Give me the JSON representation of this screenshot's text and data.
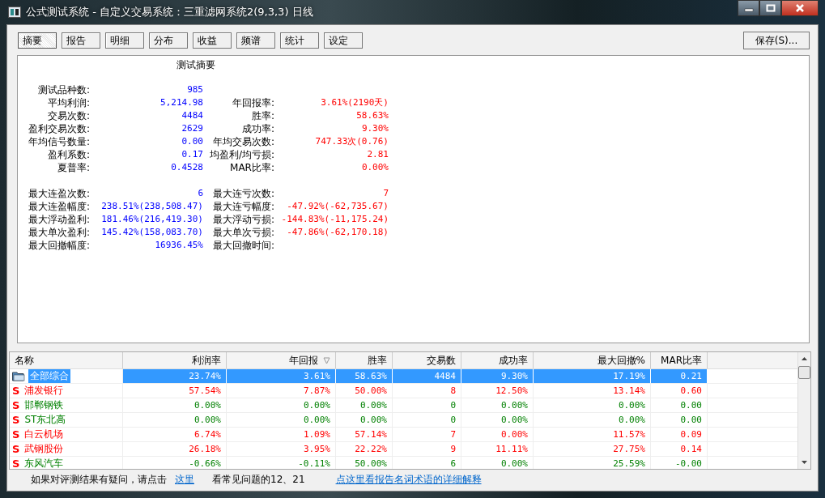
{
  "window": {
    "title": "公式测试系统 - 自定义交易系统：三重滤网系统2(9,3,3) 日线"
  },
  "tabs": [
    {
      "label": "摘要",
      "selected": true
    },
    {
      "label": "报告",
      "selected": false
    },
    {
      "label": "明细",
      "selected": false
    },
    {
      "label": "分布",
      "selected": false
    },
    {
      "label": "收益",
      "selected": false
    },
    {
      "label": "频谱",
      "selected": false
    },
    {
      "label": "统计",
      "selected": false
    },
    {
      "label": "设定",
      "selected": false
    }
  ],
  "save_button": "保存(S)...",
  "summary": {
    "title": "测试摘要",
    "groups": [
      [
        {
          "label": "测试品种数:",
          "value": "985"
        },
        {
          "label": "平均利润:",
          "value": "5,214.98",
          "label2": "年回报率:",
          "value2": "3.61%(2190天)"
        },
        {
          "label": "交易次数:",
          "value": "4484",
          "label2": "胜率:",
          "value2": "58.63%"
        },
        {
          "label": "盈利交易次数:",
          "value": "2629",
          "label2": "成功率:",
          "value2": "9.30%"
        },
        {
          "label": "年均信号数量:",
          "value": "0.00",
          "label2": "年均交易次数:",
          "value2": "747.33次(0.76)"
        },
        {
          "label": "盈利系数:",
          "value": "0.17",
          "label2": "均盈利/均亏损:",
          "value2": "2.81"
        },
        {
          "label": "夏普率:",
          "value": "0.4528",
          "label2": "MAR比率:",
          "value2": "0.00%"
        }
      ],
      [
        {
          "label": "最大连盈次数:",
          "value": "6",
          "label2": "最大连亏次数:",
          "value2": "7"
        },
        {
          "label": "最大连盈幅度:",
          "value": "238.51%(238,508.47)",
          "label2": "最大连亏幅度:",
          "value2": "-47.92%(-62,735.67)"
        },
        {
          "label": "最大浮动盈利:",
          "value": "181.46%(216,419.30)",
          "label2": "最大浮动亏损:",
          "value2": "-144.83%(-11,175.24)"
        },
        {
          "label": "最大单次盈利:",
          "value": "145.42%(158,083.70)",
          "label2": "最大单次亏损:",
          "value2": "-47.86%(-62,170.18)"
        },
        {
          "label": "最大回撤幅度:",
          "value": "16936.45%",
          "label2": "最大回撤时间:"
        }
      ]
    ]
  },
  "table": {
    "columns": [
      {
        "label": "名称",
        "sorted": false
      },
      {
        "label": "利润率",
        "sorted": false
      },
      {
        "label": "年回报",
        "sorted": true
      },
      {
        "label": "胜率",
        "sorted": false
      },
      {
        "label": "交易数",
        "sorted": false
      },
      {
        "label": "成功率",
        "sorted": false
      },
      {
        "label": "最大回撤%",
        "sorted": false
      },
      {
        "label": "MAR比率",
        "sorted": false
      }
    ],
    "rows": [
      {
        "kind": "group",
        "selected": true,
        "cells": [
          "全部综合",
          "23.74%",
          "3.61%",
          "58.63%",
          "4484",
          "9.30%",
          "17.19%",
          "0.21"
        ]
      },
      {
        "kind": "stock",
        "marker": "S",
        "selected": false,
        "profitable": true,
        "cells": [
          "浦发银行",
          "57.54%",
          "7.87%",
          "50.00%",
          "8",
          "12.50%",
          "13.14%",
          "0.60"
        ]
      },
      {
        "kind": "stock",
        "marker": "S",
        "selected": false,
        "profitable": false,
        "cells": [
          "邯郸钢铁",
          "0.00%",
          "0.00%",
          "0.00%",
          "0",
          "0.00%",
          "0.00%",
          "0.00"
        ]
      },
      {
        "kind": "stock",
        "marker": "S",
        "selected": false,
        "profitable": false,
        "cells": [
          "ST东北高",
          "0.00%",
          "0.00%",
          "0.00%",
          "0",
          "0.00%",
          "0.00%",
          "0.00"
        ]
      },
      {
        "kind": "stock",
        "marker": "S",
        "selected": false,
        "profitable": true,
        "cells": [
          "白云机场",
          "6.74%",
          "1.09%",
          "57.14%",
          "7",
          "0.00%",
          "11.57%",
          "0.09"
        ]
      },
      {
        "kind": "stock",
        "marker": "S",
        "selected": false,
        "profitable": true,
        "cells": [
          "武钢股份",
          "26.18%",
          "3.95%",
          "22.22%",
          "9",
          "11.11%",
          "27.75%",
          "0.14"
        ]
      },
      {
        "kind": "stock",
        "marker": "S",
        "selected": false,
        "profitable": false,
        "cells": [
          "东风汽车",
          "-0.66%",
          "-0.11%",
          "50.00%",
          "6",
          "0.00%",
          "25.59%",
          "-0.00"
        ]
      }
    ]
  },
  "footer": {
    "text": "如果对评测结果有疑问，请点击",
    "link": "这里",
    "text2": "看常见问题的12、21",
    "link2": "点这里看报告名词术语的详细解释"
  }
}
